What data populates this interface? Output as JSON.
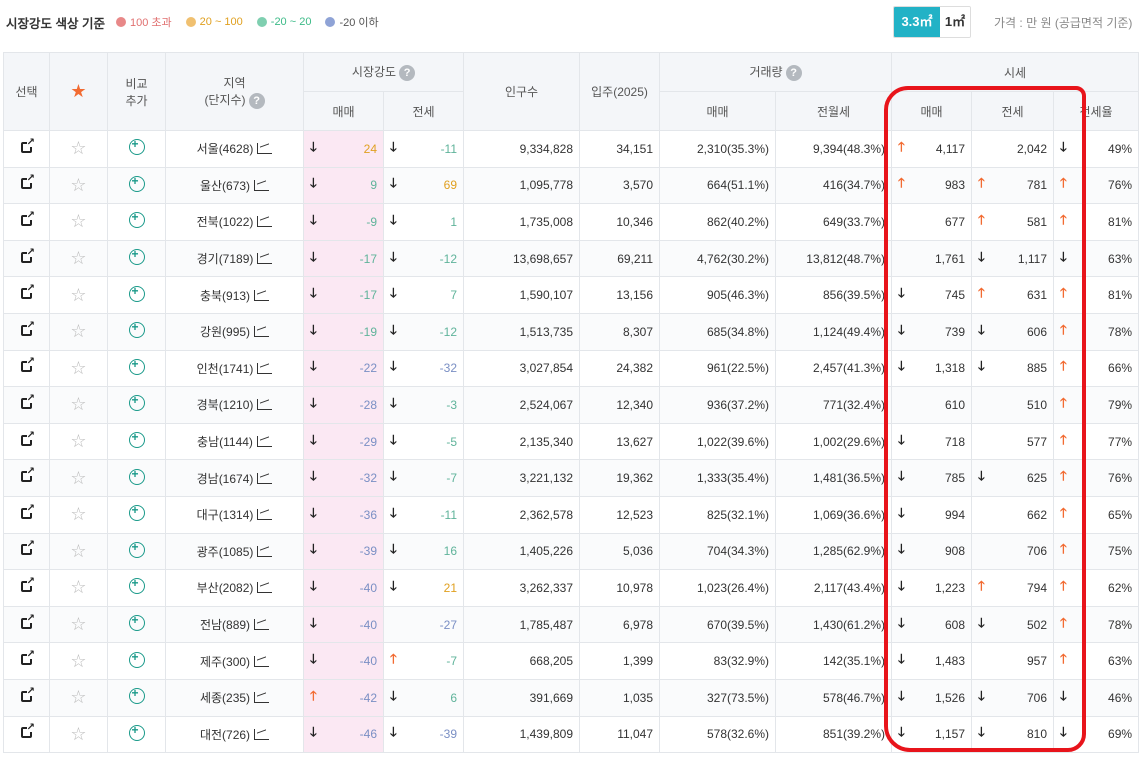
{
  "legend": {
    "title": "시장강도 색상 기준",
    "items": [
      {
        "label": "100 초과",
        "color": "#e88888"
      },
      {
        "label": "20 ~ 100",
        "color": "#f0c070"
      },
      {
        "label": "-20 ~ 20",
        "color": "#7fcfb0"
      },
      {
        "label": "-20 이하",
        "color": "#8fa3d6"
      }
    ]
  },
  "unit_toggle": {
    "active": "3.3㎡",
    "inactive": "1㎡"
  },
  "price_note": "가격 : 만 원 (공급면적 기준)",
  "headers": {
    "select": "선택",
    "compare_line1": "비교",
    "compare_line2": "추가",
    "region_line1": "지역",
    "region_line2": "(단지수)",
    "market_strength": "시장강도",
    "population": "인구수",
    "move_in": "입주(2025)",
    "volume": "거래량",
    "price": "시세",
    "sale": "매매",
    "jeonse": "전세",
    "jeonse_monthly": "전월세",
    "jeonse_ratio": "전세율",
    "help": "?"
  },
  "rows": [
    {
      "region": "서울(4628)",
      "ms_sale": "24",
      "ms_sale_dir": "down",
      "ms_sale_color": "o",
      "ms_jeonse": "-11",
      "ms_jeonse_dir": "down",
      "ms_jeonse_color": "g",
      "population": "9,334,828",
      "move_in": "34,151",
      "vol_sale": "2,310(35.3%)",
      "vol_jeonse": "9,394(48.3%)",
      "p_sale_dir": "up",
      "p_sale": "4,117",
      "p_jeonse_dir": "",
      "p_jeonse": "2,042",
      "ratio_dir": "down",
      "ratio": "49%"
    },
    {
      "region": "울산(673)",
      "ms_sale": "9",
      "ms_sale_dir": "down",
      "ms_sale_color": "g",
      "ms_jeonse": "69",
      "ms_jeonse_dir": "down",
      "ms_jeonse_color": "o",
      "population": "1,095,778",
      "move_in": "3,570",
      "vol_sale": "664(51.1%)",
      "vol_jeonse": "416(34.7%)",
      "p_sale_dir": "up",
      "p_sale": "983",
      "p_jeonse_dir": "up",
      "p_jeonse": "781",
      "ratio_dir": "up",
      "ratio": "76%"
    },
    {
      "region": "전북(1022)",
      "ms_sale": "-9",
      "ms_sale_dir": "down",
      "ms_sale_color": "g",
      "ms_jeonse": "1",
      "ms_jeonse_dir": "down",
      "ms_jeonse_color": "g",
      "population": "1,735,008",
      "move_in": "10,346",
      "vol_sale": "862(40.2%)",
      "vol_jeonse": "649(33.7%)",
      "p_sale_dir": "",
      "p_sale": "677",
      "p_jeonse_dir": "up",
      "p_jeonse": "581",
      "ratio_dir": "up",
      "ratio": "81%"
    },
    {
      "region": "경기(7189)",
      "ms_sale": "-17",
      "ms_sale_dir": "down",
      "ms_sale_color": "g",
      "ms_jeonse": "-12",
      "ms_jeonse_dir": "down",
      "ms_jeonse_color": "g",
      "population": "13,698,657",
      "move_in": "69,211",
      "vol_sale": "4,762(30.2%)",
      "vol_jeonse": "13,812(48.7%)",
      "p_sale_dir": "",
      "p_sale": "1,761",
      "p_jeonse_dir": "down",
      "p_jeonse": "1,117",
      "ratio_dir": "down",
      "ratio": "63%"
    },
    {
      "region": "충북(913)",
      "ms_sale": "-17",
      "ms_sale_dir": "down",
      "ms_sale_color": "g",
      "ms_jeonse": "7",
      "ms_jeonse_dir": "down",
      "ms_jeonse_color": "g",
      "population": "1,590,107",
      "move_in": "13,156",
      "vol_sale": "905(46.3%)",
      "vol_jeonse": "856(39.5%)",
      "p_sale_dir": "down",
      "p_sale": "745",
      "p_jeonse_dir": "up",
      "p_jeonse": "631",
      "ratio_dir": "up",
      "ratio": "81%"
    },
    {
      "region": "강원(995)",
      "ms_sale": "-19",
      "ms_sale_dir": "down",
      "ms_sale_color": "g",
      "ms_jeonse": "-12",
      "ms_jeonse_dir": "down",
      "ms_jeonse_color": "g",
      "population": "1,513,735",
      "move_in": "8,307",
      "vol_sale": "685(34.8%)",
      "vol_jeonse": "1,124(49.4%)",
      "p_sale_dir": "down",
      "p_sale": "739",
      "p_jeonse_dir": "down",
      "p_jeonse": "606",
      "ratio_dir": "up",
      "ratio": "78%"
    },
    {
      "region": "인천(1741)",
      "ms_sale": "-22",
      "ms_sale_dir": "down",
      "ms_sale_color": "n",
      "ms_jeonse": "-32",
      "ms_jeonse_dir": "down",
      "ms_jeonse_color": "n",
      "population": "3,027,854",
      "move_in": "24,382",
      "vol_sale": "961(22.5%)",
      "vol_jeonse": "2,457(41.3%)",
      "p_sale_dir": "down",
      "p_sale": "1,318",
      "p_jeonse_dir": "down",
      "p_jeonse": "885",
      "ratio_dir": "up",
      "ratio": "66%"
    },
    {
      "region": "경북(1210)",
      "ms_sale": "-28",
      "ms_sale_dir": "down",
      "ms_sale_color": "n",
      "ms_jeonse": "-3",
      "ms_jeonse_dir": "down",
      "ms_jeonse_color": "g",
      "population": "2,524,067",
      "move_in": "12,340",
      "vol_sale": "936(37.2%)",
      "vol_jeonse": "771(32.4%)",
      "p_sale_dir": "",
      "p_sale": "610",
      "p_jeonse_dir": "",
      "p_jeonse": "510",
      "ratio_dir": "up",
      "ratio": "79%"
    },
    {
      "region": "충남(1144)",
      "ms_sale": "-29",
      "ms_sale_dir": "down",
      "ms_sale_color": "n",
      "ms_jeonse": "-5",
      "ms_jeonse_dir": "down",
      "ms_jeonse_color": "g",
      "population": "2,135,340",
      "move_in": "13,627",
      "vol_sale": "1,022(39.6%)",
      "vol_jeonse": "1,002(29.6%)",
      "p_sale_dir": "down",
      "p_sale": "718",
      "p_jeonse_dir": "",
      "p_jeonse": "577",
      "ratio_dir": "up",
      "ratio": "77%"
    },
    {
      "region": "경남(1674)",
      "ms_sale": "-32",
      "ms_sale_dir": "down",
      "ms_sale_color": "n",
      "ms_jeonse": "-7",
      "ms_jeonse_dir": "down",
      "ms_jeonse_color": "g",
      "population": "3,221,132",
      "move_in": "19,362",
      "vol_sale": "1,333(35.4%)",
      "vol_jeonse": "1,481(36.5%)",
      "p_sale_dir": "down",
      "p_sale": "785",
      "p_jeonse_dir": "down",
      "p_jeonse": "625",
      "ratio_dir": "up",
      "ratio": "76%"
    },
    {
      "region": "대구(1314)",
      "ms_sale": "-36",
      "ms_sale_dir": "down",
      "ms_sale_color": "n",
      "ms_jeonse": "-11",
      "ms_jeonse_dir": "down",
      "ms_jeonse_color": "g",
      "population": "2,362,578",
      "move_in": "12,523",
      "vol_sale": "825(32.1%)",
      "vol_jeonse": "1,069(36.6%)",
      "p_sale_dir": "down",
      "p_sale": "994",
      "p_jeonse_dir": "",
      "p_jeonse": "662",
      "ratio_dir": "up",
      "ratio": "65%"
    },
    {
      "region": "광주(1085)",
      "ms_sale": "-39",
      "ms_sale_dir": "down",
      "ms_sale_color": "n",
      "ms_jeonse": "16",
      "ms_jeonse_dir": "down",
      "ms_jeonse_color": "g",
      "population": "1,405,226",
      "move_in": "5,036",
      "vol_sale": "704(34.3%)",
      "vol_jeonse": "1,285(62.9%)",
      "p_sale_dir": "down",
      "p_sale": "908",
      "p_jeonse_dir": "",
      "p_jeonse": "706",
      "ratio_dir": "up",
      "ratio": "75%"
    },
    {
      "region": "부산(2082)",
      "ms_sale": "-40",
      "ms_sale_dir": "down",
      "ms_sale_color": "n",
      "ms_jeonse": "21",
      "ms_jeonse_dir": "down",
      "ms_jeonse_color": "o",
      "population": "3,262,337",
      "move_in": "10,978",
      "vol_sale": "1,023(26.4%)",
      "vol_jeonse": "2,117(43.4%)",
      "p_sale_dir": "down",
      "p_sale": "1,223",
      "p_jeonse_dir": "up",
      "p_jeonse": "794",
      "ratio_dir": "up",
      "ratio": "62%"
    },
    {
      "region": "전남(889)",
      "ms_sale": "-40",
      "ms_sale_dir": "down",
      "ms_sale_color": "n",
      "ms_jeonse": "-27",
      "ms_jeonse_dir": "",
      "ms_jeonse_color": "n",
      "population": "1,785,487",
      "move_in": "6,978",
      "vol_sale": "670(39.5%)",
      "vol_jeonse": "1,430(61.2%)",
      "p_sale_dir": "down",
      "p_sale": "608",
      "p_jeonse_dir": "down",
      "p_jeonse": "502",
      "ratio_dir": "up",
      "ratio": "78%"
    },
    {
      "region": "제주(300)",
      "ms_sale": "-40",
      "ms_sale_dir": "down",
      "ms_sale_color": "n",
      "ms_jeonse": "-7",
      "ms_jeonse_dir": "up",
      "ms_jeonse_color": "g",
      "population": "668,205",
      "move_in": "1,399",
      "vol_sale": "83(32.9%)",
      "vol_jeonse": "142(35.1%)",
      "p_sale_dir": "down",
      "p_sale": "1,483",
      "p_jeonse_dir": "",
      "p_jeonse": "957",
      "ratio_dir": "up",
      "ratio": "63%"
    },
    {
      "region": "세종(235)",
      "ms_sale": "-42",
      "ms_sale_dir": "up",
      "ms_sale_color": "n",
      "ms_jeonse": "6",
      "ms_jeonse_dir": "down",
      "ms_jeonse_color": "g",
      "population": "391,669",
      "move_in": "1,035",
      "vol_sale": "327(73.5%)",
      "vol_jeonse": "578(46.7%)",
      "p_sale_dir": "down",
      "p_sale": "1,526",
      "p_jeonse_dir": "down",
      "p_jeonse": "706",
      "ratio_dir": "down",
      "ratio": "46%"
    },
    {
      "region": "대전(726)",
      "ms_sale": "-46",
      "ms_sale_dir": "down",
      "ms_sale_color": "n",
      "ms_jeonse": "-39",
      "ms_jeonse_dir": "down",
      "ms_jeonse_color": "n",
      "population": "1,439,809",
      "move_in": "11,047",
      "vol_sale": "578(32.6%)",
      "vol_jeonse": "851(39.2%)",
      "p_sale_dir": "down",
      "p_sale": "1,157",
      "p_jeonse_dir": "down",
      "p_jeonse": "810",
      "ratio_dir": "down",
      "ratio": "69%"
    }
  ]
}
